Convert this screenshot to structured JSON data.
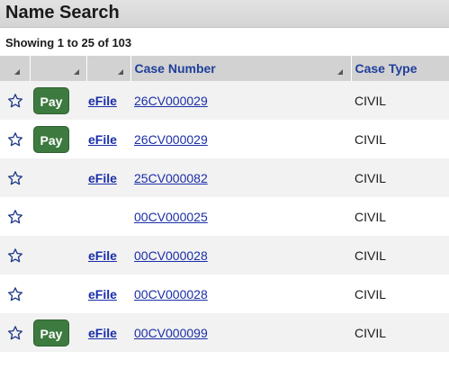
{
  "header": {
    "title": "Name Search"
  },
  "paging": {
    "showing": "Showing 1 to 25 of 103"
  },
  "table": {
    "columns": [
      "",
      "",
      "",
      "Case Number",
      "Case Type"
    ],
    "rows": [
      {
        "pay": "Pay",
        "efile": "eFile",
        "case_number": "26CV000029",
        "case_type": "CIVIL"
      },
      {
        "pay": "Pay",
        "efile": "eFile",
        "case_number": "26CV000029",
        "case_type": "CIVIL"
      },
      {
        "pay": "",
        "efile": "eFile",
        "case_number": "25CV000082",
        "case_type": "CIVIL"
      },
      {
        "pay": "",
        "efile": "",
        "case_number": "00CV000025",
        "case_type": "CIVIL"
      },
      {
        "pay": "",
        "efile": "eFile",
        "case_number": "00CV000028",
        "case_type": "CIVIL"
      },
      {
        "pay": "",
        "efile": "eFile",
        "case_number": "00CV000028",
        "case_type": "CIVIL"
      },
      {
        "pay": "Pay",
        "efile": "eFile",
        "case_number": "00CV000099",
        "case_type": "CIVIL"
      }
    ]
  },
  "icons": {
    "favorite": "star-outline-icon",
    "sort": "sort-icon"
  },
  "colors": {
    "pay_button": "#3d7a3f",
    "link": "#1a2ea8",
    "header_text": "#1f3f9a"
  }
}
